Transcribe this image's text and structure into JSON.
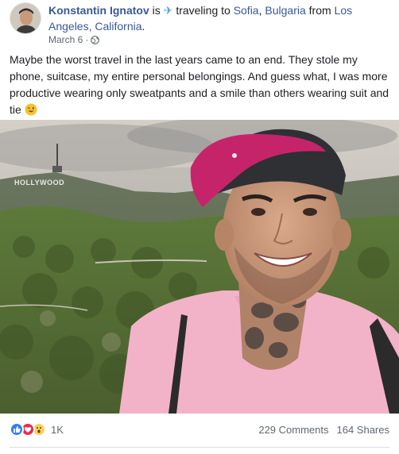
{
  "author": {
    "name": "Konstantin Ignatov",
    "activity_prefix": "is",
    "activity_icon": "airplane-icon",
    "activity_text": "traveling to",
    "destination_city": "Sofia",
    "destination_country": "Bulgaria",
    "from_word": "from",
    "origin": "Los Angeles, California",
    "comma": ","
  },
  "meta": {
    "date": "March 6",
    "separator": "·",
    "privacy_icon": "globe-icon"
  },
  "post": {
    "text": "Maybe the worst travel in the last years came to an end. They stole my phone, suitcase, my entire personal belongings. And guess what, I was more productive wearing only sweatpants and a smile than others wearing suit and tie",
    "emoji": "winking-face-emoji"
  },
  "photo": {
    "sign_text": "HOLLYWOOD"
  },
  "footer": {
    "reaction_icons": [
      "like-reaction-icon",
      "love-reaction-icon",
      "wow-reaction-icon"
    ],
    "reaction_count": "1K",
    "comments": "229 Comments",
    "shares": "164 Shares"
  },
  "colors": {
    "link": "#385898",
    "meta": "#616770",
    "shirt": "#f2b3c8",
    "cap": "#c6246a",
    "sky": "#c9c4bd"
  }
}
